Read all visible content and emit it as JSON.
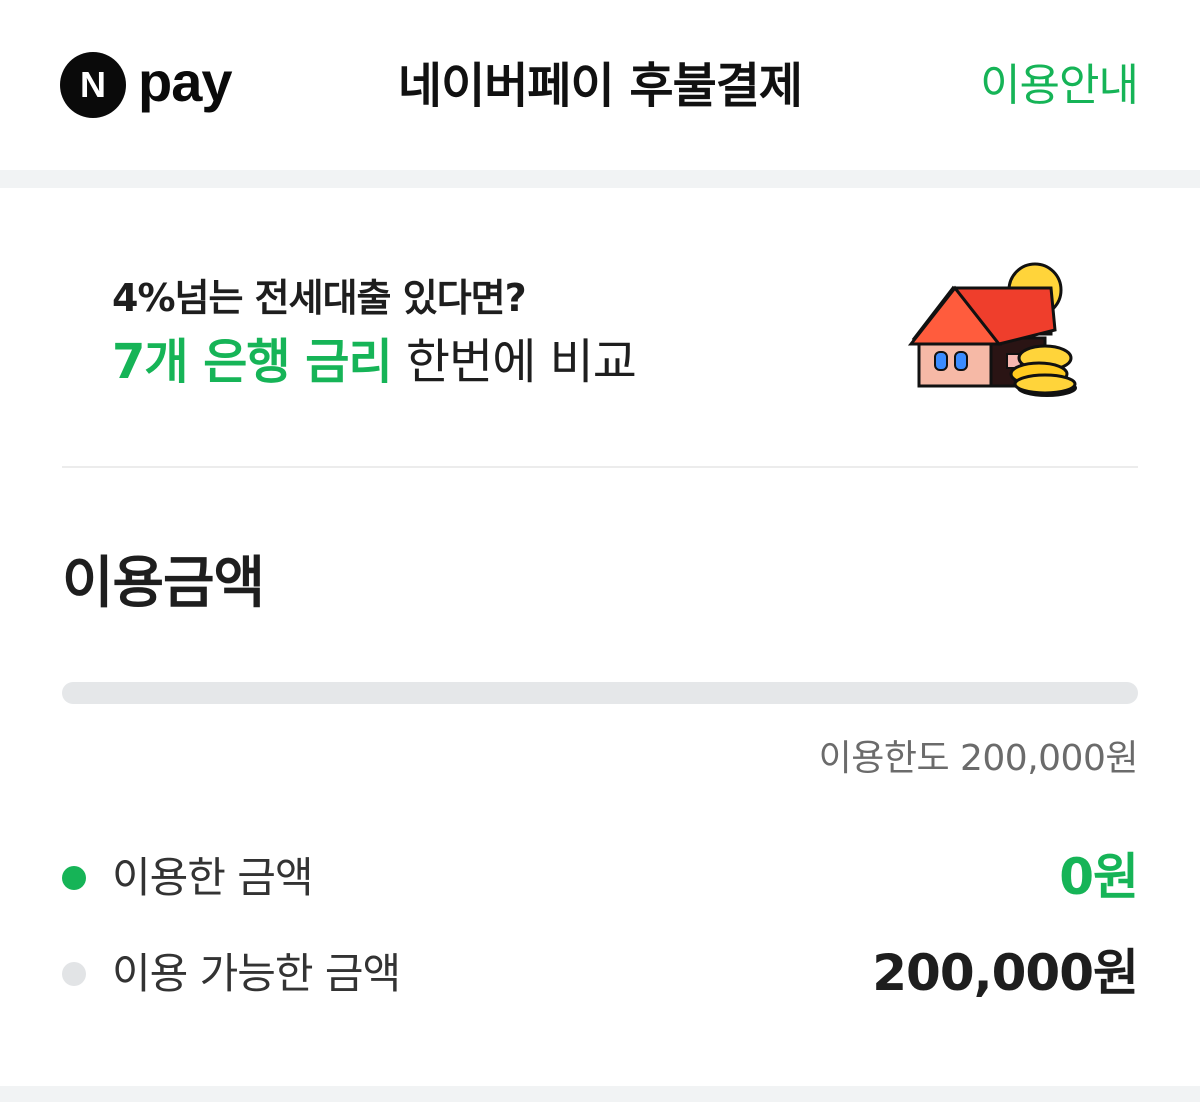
{
  "header": {
    "logo_mark": "N",
    "logo_text": "pay",
    "title": "네이버페이 후불결제",
    "guide_link": "이용안내"
  },
  "banner": {
    "line1": "4%넘는 전세대출 있다면?",
    "line2_highlight": "7개 은행 금리",
    "line2_rest": " 한번에 비교",
    "illustration": "house-with-coins-illustration"
  },
  "usage": {
    "title": "이용금액",
    "progress_fraction": 0,
    "limit_text": "이용한도 200,000원",
    "used": {
      "label": "이용한 금액",
      "value": "0원"
    },
    "available": {
      "label": "이용 가능한 금액",
      "value": "200,000원"
    }
  },
  "colors": {
    "accent_green": "#16b457",
    "track_gray": "#e5e7e9",
    "dot_gray": "#e2e4e6",
    "separator": "#f1f3f4"
  }
}
